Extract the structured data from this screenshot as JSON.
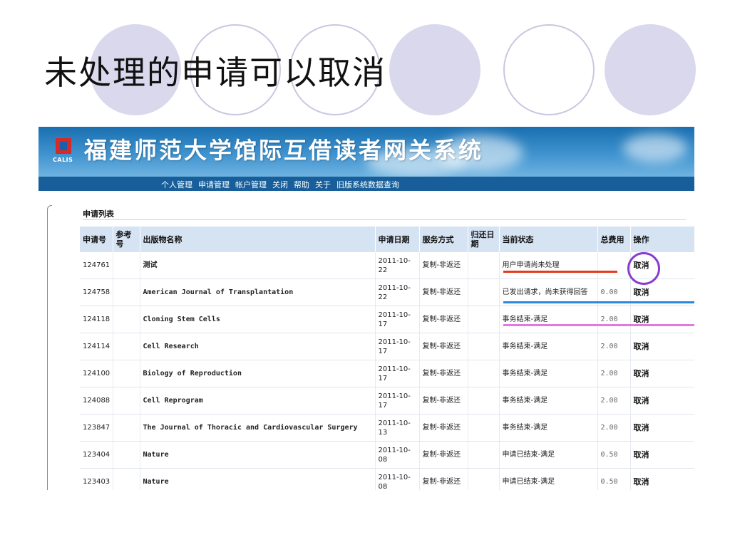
{
  "slide": {
    "title": "未处理的申请可以取消"
  },
  "header": {
    "logo_text": "CALIS",
    "system_title": "福建师范大学馆际互借读者网关系统",
    "nav": [
      "个人管理",
      "申请管理",
      "帐户管理",
      "关闭",
      "帮助",
      "关于",
      "旧版系统数据查询"
    ]
  },
  "list": {
    "title": "申请列表",
    "columns": [
      "申请号",
      "参考号",
      "出版物名称",
      "申请日期",
      "服务方式",
      "归还日期",
      "当前状态",
      "总费用",
      "操作"
    ],
    "rows": [
      {
        "id": "124761",
        "ref": "",
        "title": "测试",
        "date": "2011-10-22",
        "service": "复制-非返还",
        "return": "",
        "status": "用户申请尚未处理",
        "fee": "",
        "action": "取消"
      },
      {
        "id": "124758",
        "ref": "",
        "title": "American Journal of Transplantation",
        "date": "2011-10-22",
        "service": "复制-非返还",
        "return": "",
        "status": "已发出请求，尚未获得回答",
        "fee": "0.00",
        "action": "取消"
      },
      {
        "id": "124118",
        "ref": "",
        "title": "Cloning Stem Cells",
        "date": "2011-10-17",
        "service": "复制-非返还",
        "return": "",
        "status": "事务结束-满足",
        "fee": "2.00",
        "action": "取消"
      },
      {
        "id": "124114",
        "ref": "",
        "title": "Cell Research",
        "date": "2011-10-17",
        "service": "复制-非返还",
        "return": "",
        "status": "事务结束-满足",
        "fee": "2.00",
        "action": "取消"
      },
      {
        "id": "124100",
        "ref": "",
        "title": "Biology of Reproduction",
        "date": "2011-10-17",
        "service": "复制-非返还",
        "return": "",
        "status": "事务结束-满足",
        "fee": "2.00",
        "action": "取消"
      },
      {
        "id": "124088",
        "ref": "",
        "title": "Cell Reprogram",
        "date": "2011-10-17",
        "service": "复制-非返还",
        "return": "",
        "status": "事务结束-满足",
        "fee": "2.00",
        "action": "取消"
      },
      {
        "id": "123847",
        "ref": "",
        "title": "The Journal of Thoracic and Cardiovascular Surgery",
        "date": "2011-10-13",
        "service": "复制-非返还",
        "return": "",
        "status": "事务结束-满足",
        "fee": "2.00",
        "action": "取消"
      },
      {
        "id": "123404",
        "ref": "",
        "title": "Nature",
        "date": "2011-10-08",
        "service": "复制-非返还",
        "return": "",
        "status": "申请已结束-满足",
        "fee": "0.50",
        "action": "取消"
      },
      {
        "id": "123403",
        "ref": "",
        "title": "Nature",
        "date": "2011-10-08",
        "service": "复制-非返还",
        "return": "",
        "status": "申请已结束-满足",
        "fee": "0.50",
        "action": "取消"
      }
    ]
  },
  "colors": {
    "decor_circle": "#d9d8ec",
    "banner_blue": "#1a6fb0",
    "header_row": "#d5e3f2",
    "mark_red": "#e63a1f",
    "mark_blue": "#2a86e0",
    "mark_pink": "#e07ae0",
    "ring_purple": "#8a3bd0"
  }
}
